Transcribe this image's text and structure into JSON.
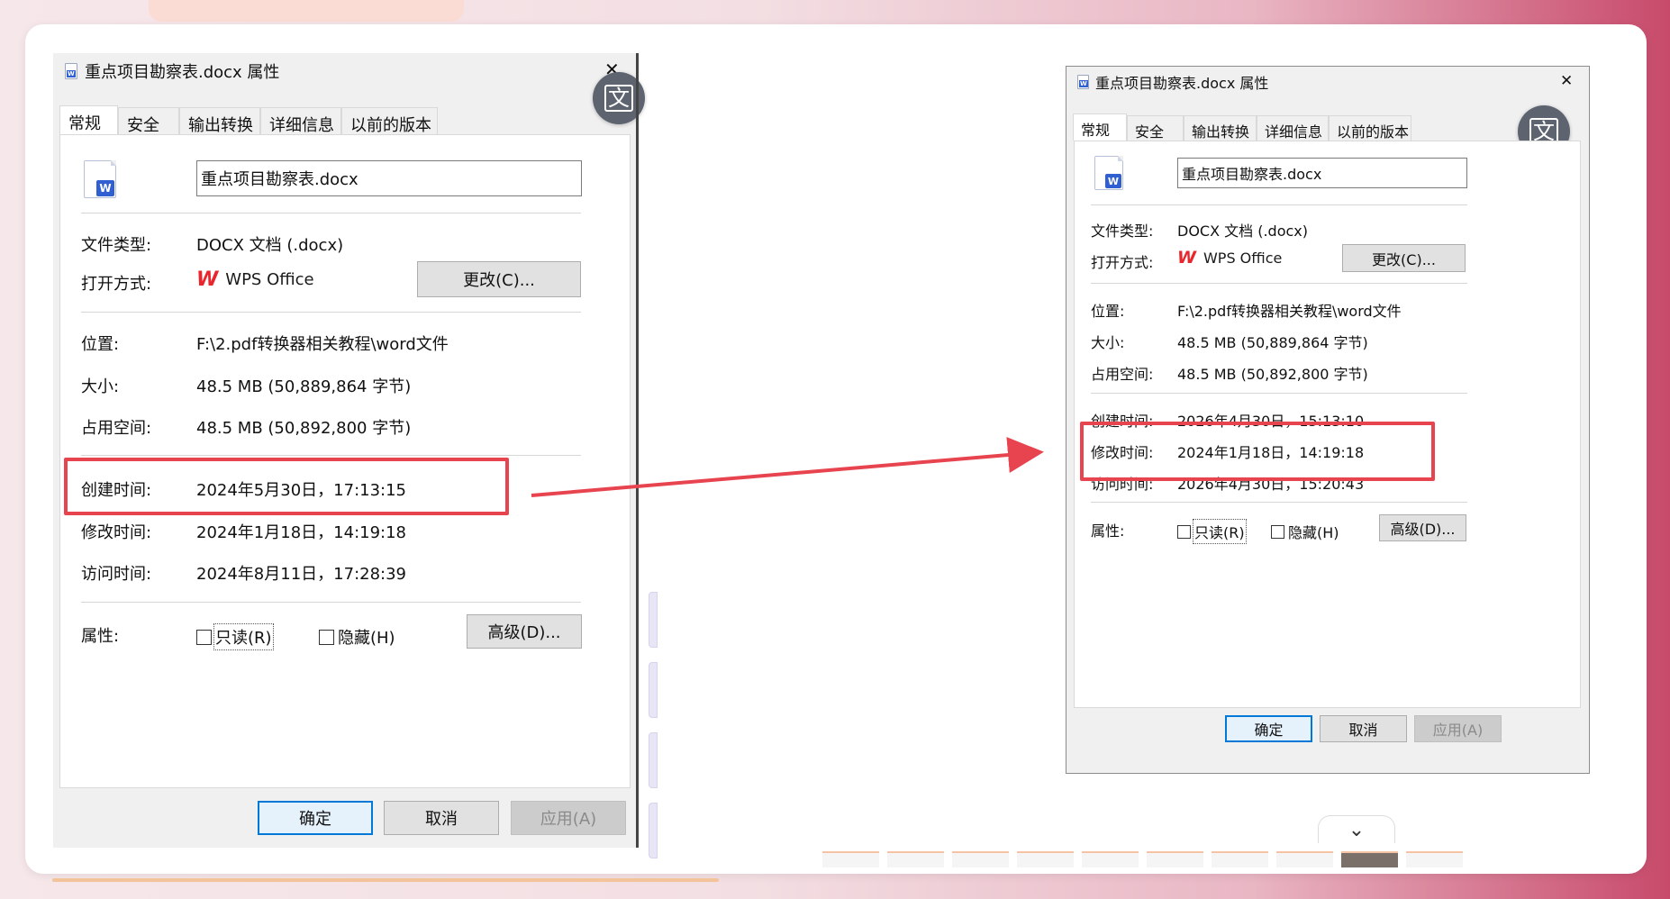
{
  "colors": {
    "highlight": "#e8444f",
    "accent": "#0078d7",
    "wps": "#e8262b",
    "word": "#2f5fd1"
  },
  "icons": {
    "doc_small": "word-doc-icon",
    "doc_big": "word-doc-icon",
    "close": "close-icon",
    "translate": "translate-icon",
    "wps": "wps-logo-icon",
    "chevron": "chevron-down-icon"
  },
  "translate_glyph": "文",
  "close_glyph": "✕",
  "chevron_glyph": "⌄",
  "left": {
    "title": "重点项目勘察表.docx 属性",
    "tabs": [
      {
        "label": "常规"
      },
      {
        "label": "安全"
      },
      {
        "label": "输出转换"
      },
      {
        "label": "详细信息"
      },
      {
        "label": "以前的版本"
      }
    ],
    "filename": "重点项目勘察表.docx",
    "type_label": "文件类型:",
    "type_value": "DOCX 文档 (.docx)",
    "open_label": "打开方式:",
    "open_value": "WPS Office",
    "change_button": "更改(C)...",
    "location_label": "位置:",
    "location_value": "F:\\2.pdf转换器相关教程\\word文件",
    "size_label": "大小:",
    "size_value": "48.5 MB (50,889,864 字节)",
    "disk_label": "占用空间:",
    "disk_value": "48.5 MB (50,892,800 字节)",
    "created_label": "创建时间:",
    "created_value": "2024年5月30日，17:13:15",
    "modified_label": "修改时间:",
    "modified_value": "2024年1月18日，14:19:18",
    "accessed_label": "访问时间:",
    "accessed_value": "2024年8月11日，17:28:39",
    "attr_label": "属性:",
    "readonly": "只读(R)",
    "hidden": "隐藏(H)",
    "advanced_button": "高级(D)...",
    "ok": "确定",
    "cancel": "取消",
    "apply": "应用(A)"
  },
  "right": {
    "title": "重点项目勘察表.docx 属性",
    "tabs": [
      {
        "label": "常规"
      },
      {
        "label": "安全"
      },
      {
        "label": "输出转换"
      },
      {
        "label": "详细信息"
      },
      {
        "label": "以前的版本"
      }
    ],
    "filename": "重点项目勘察表.docx",
    "type_label": "文件类型:",
    "type_value": "DOCX 文档 (.docx)",
    "open_label": "打开方式:",
    "open_value": "WPS Office",
    "change_button": "更改(C)...",
    "location_label": "位置:",
    "location_value": "F:\\2.pdf转换器相关教程\\word文件",
    "size_label": "大小:",
    "size_value": "48.5 MB (50,889,864 字节)",
    "disk_label": "占用空间:",
    "disk_value": "48.5 MB (50,892,800 字节)",
    "created_label": "创建时间:",
    "created_value": "2026年4月30日，15:13:10",
    "modified_label": "修改时间:",
    "modified_value": "2024年1月18日，14:19:18",
    "accessed_label": "访问时间:",
    "accessed_value": "2026年4月30日，15:20:43",
    "attr_label": "属性:",
    "readonly": "只读(R)",
    "hidden": "隐藏(H)",
    "advanced_button": "高级(D)...",
    "ok": "确定",
    "cancel": "取消",
    "apply": "应用(A)"
  }
}
